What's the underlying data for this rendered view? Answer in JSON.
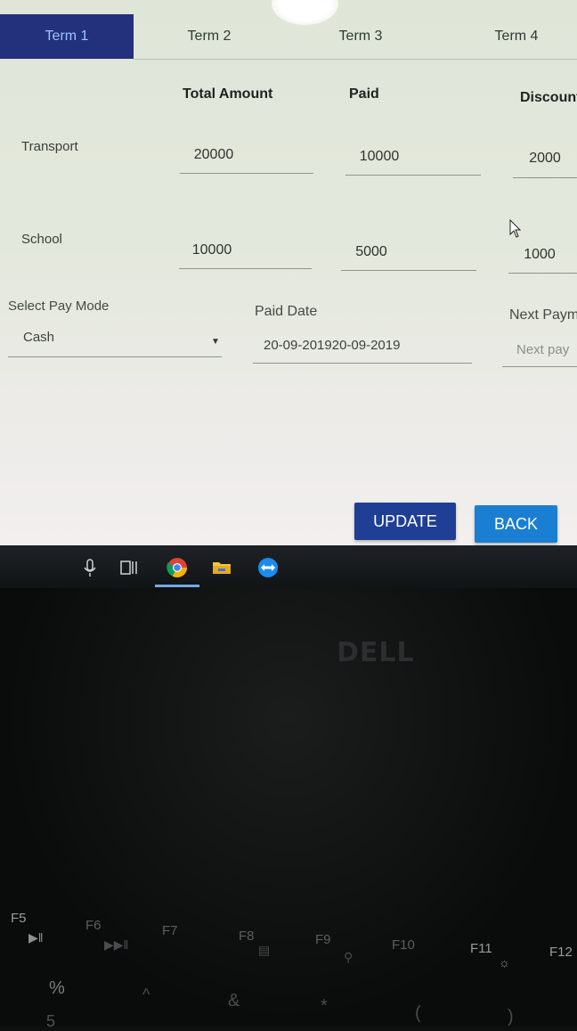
{
  "tabs": [
    {
      "label": "Term 1",
      "active": true
    },
    {
      "label": "Term 2",
      "active": false
    },
    {
      "label": "Term 3",
      "active": false
    },
    {
      "label": "Term 4",
      "active": false
    }
  ],
  "table": {
    "headers": [
      "Total Amount",
      "Paid",
      "Discount"
    ],
    "rows": [
      {
        "label": "Transport",
        "total": "20000",
        "paid": "10000",
        "discount": "2000"
      },
      {
        "label": "School",
        "total": "10000",
        "paid": "5000",
        "discount": "1000"
      }
    ]
  },
  "pay_mode": {
    "label": "Select Pay Mode",
    "value": "Cash"
  },
  "paid_date": {
    "label": "Paid Date",
    "value": "20-09-201920-09-2019"
  },
  "next_payment": {
    "label": "Next Paym",
    "placeholder": "Next pay"
  },
  "buttons": {
    "update": "UPDATE",
    "back": "BACK"
  },
  "colors": {
    "active_tab": "#23317c",
    "update_button": "#1f3f94",
    "back_button": "#1a7fd2"
  },
  "taskbar_icons": [
    "microphone-icon",
    "task-view-icon",
    "chrome-icon",
    "file-explorer-icon",
    "teamviewer-icon"
  ],
  "laptop": {
    "brand": "DELL",
    "fkeys": [
      "F5",
      "F6",
      "F7",
      "F8",
      "F9",
      "F10",
      "F11",
      "F12"
    ],
    "symbols": [
      "%",
      "5",
      "^",
      "&",
      "*",
      "(",
      ")"
    ]
  }
}
